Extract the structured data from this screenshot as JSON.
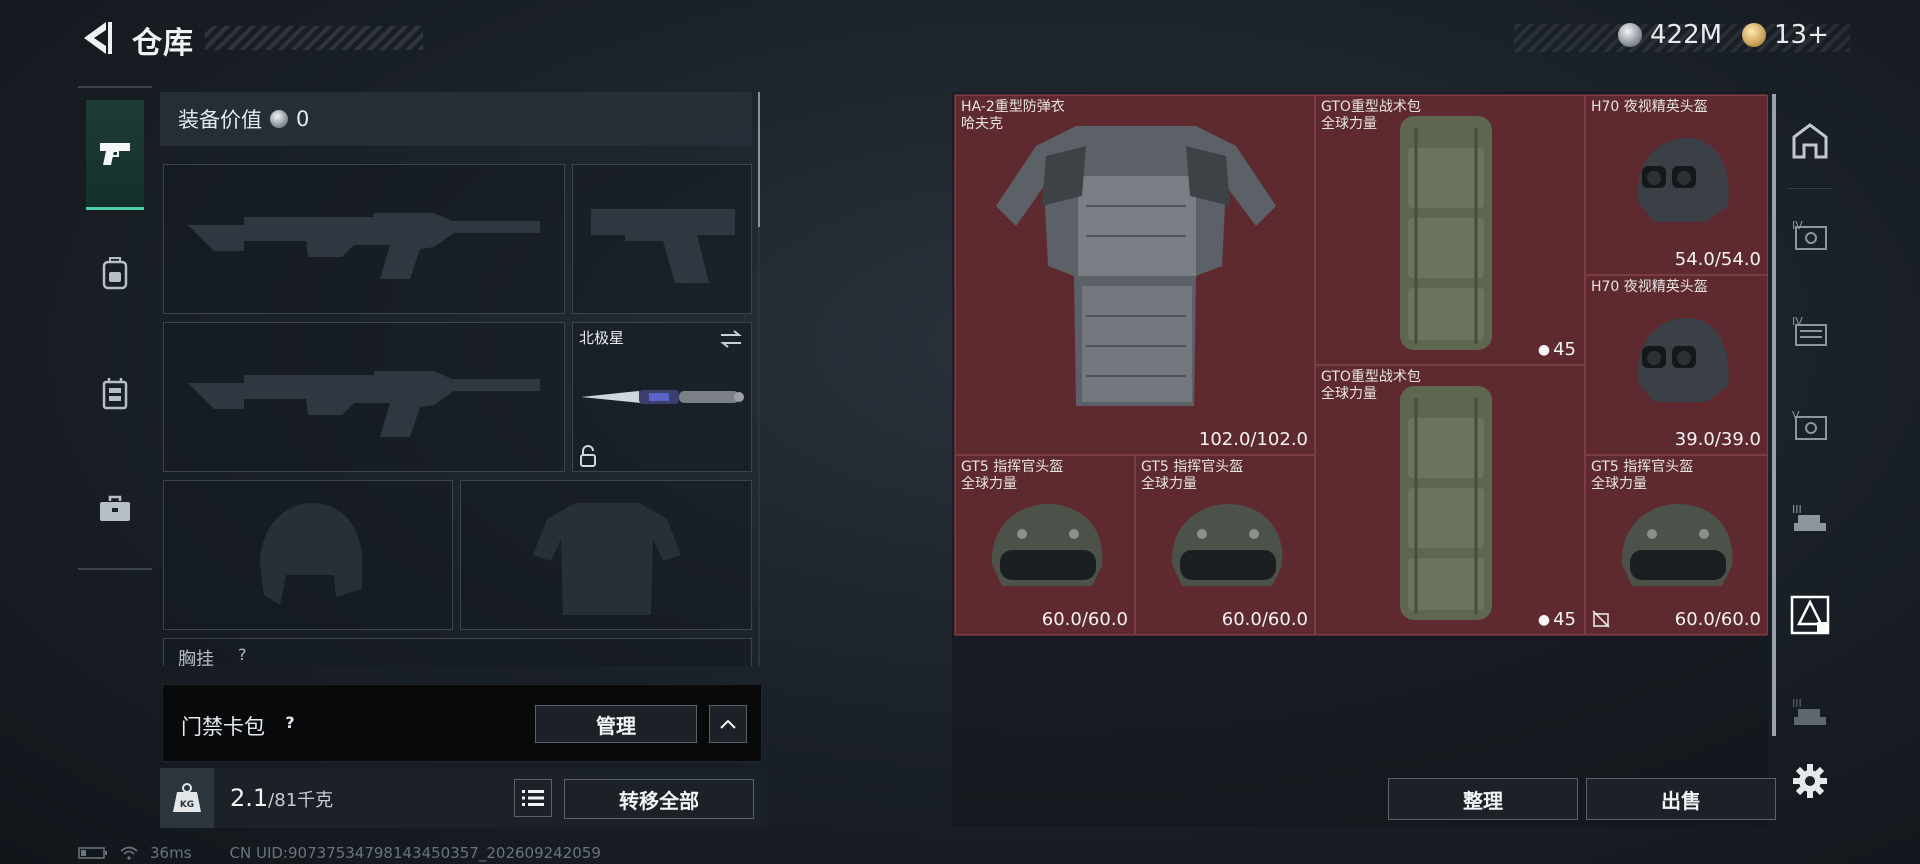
{
  "header": {
    "title": "仓库",
    "currencies": [
      {
        "icon": "silver-coin-icon",
        "value": "422M"
      },
      {
        "icon": "gold-coin-icon",
        "value": "13+"
      }
    ]
  },
  "left_rail": {
    "tabs": [
      {
        "icon": "pistol-icon",
        "active": true
      },
      {
        "icon": "backpack-icon",
        "active": false
      },
      {
        "icon": "chest-rig-icon",
        "active": false
      },
      {
        "icon": "toolbox-icon",
        "active": false
      }
    ]
  },
  "loadout": {
    "equip_value_label": "装备价值",
    "equip_value": "0",
    "melee_slot_label": "北极星",
    "chest_rig_label": "胸挂",
    "chest_rig_help": "?"
  },
  "keycard": {
    "label": "门禁卡包",
    "help": "?",
    "manage_label": "管理"
  },
  "weight": {
    "icon_text": "KG",
    "current": "2.1",
    "max": "/81千克",
    "transfer_all_label": "转移全部"
  },
  "status": {
    "ping": "36ms",
    "uid": "CN UID:90737534798143450357_202609242059"
  },
  "stash": {
    "items": [
      {
        "id": "armor",
        "name": "HA-2重型防弹衣",
        "sub": "哈夫克",
        "durability": "102.0/102.0",
        "type": "armor"
      },
      {
        "id": "backpack1",
        "name": "GTO重型战术包",
        "sub": "全球力量",
        "count": "45",
        "type": "backpack"
      },
      {
        "id": "helmet-nv1",
        "name": "H70 夜视精英头盔",
        "sub": "",
        "durability": "54.0/54.0",
        "type": "nv-helmet"
      },
      {
        "id": "helmet-nv2",
        "name": "H70 夜视精英头盔",
        "sub": "",
        "durability": "39.0/39.0",
        "type": "nv-helmet"
      },
      {
        "id": "backpack2",
        "name": "GTO重型战术包",
        "sub": "全球力量",
        "count": "45",
        "type": "backpack"
      },
      {
        "id": "helmet-gt1",
        "name": "GT5 指挥官头盔",
        "sub": "全球力量",
        "durability": "60.0/60.0",
        "type": "helmet"
      },
      {
        "id": "helmet-gt2",
        "name": "GT5 指挥官头盔",
        "sub": "全球力量",
        "durability": "60.0/60.0",
        "type": "helmet"
      },
      {
        "id": "helmet-gt3",
        "name": "GT5 指挥官头盔",
        "sub": "全球力量",
        "durability": "60.0/60.0",
        "type": "helmet"
      }
    ],
    "sort_label": "整理",
    "sell_label": "出售"
  },
  "right_rail": {
    "tabs": [
      {
        "icon": "safe-box-icon"
      },
      {
        "icon": "storage-iv-a-icon"
      },
      {
        "icon": "storage-iv-b-icon"
      },
      {
        "icon": "storage-v-icon"
      },
      {
        "icon": "storage-iii-a-icon"
      },
      {
        "icon": "storage-active-icon"
      },
      {
        "icon": "storage-iii-b-icon"
      },
      {
        "icon": "settings-gear-icon"
      }
    ]
  },
  "colors": {
    "accent_green": "#4fd1a8",
    "stash_bg": "#5e2a30",
    "background": "#1a2027"
  }
}
